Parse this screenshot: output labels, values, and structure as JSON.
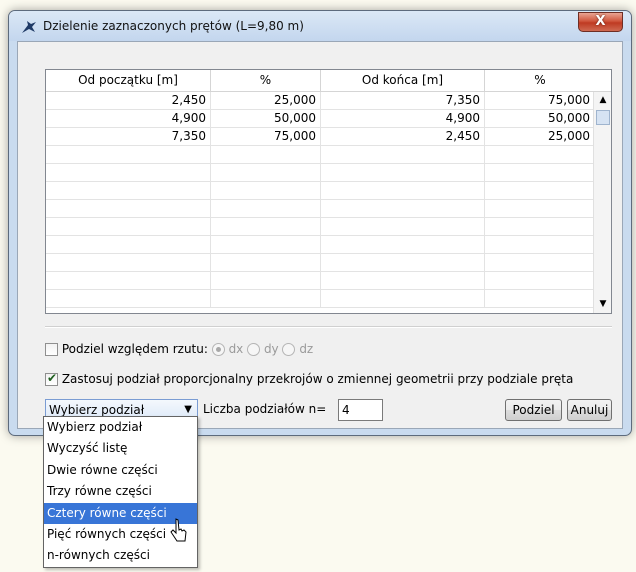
{
  "window": {
    "title": "Dzielenie zaznaczonych prętów (L=9,80 m)",
    "close_label": "X"
  },
  "grid": {
    "columns": [
      "Od początku [m]",
      "%",
      "Od końca [m]",
      "%"
    ],
    "rows": [
      [
        "2,450",
        "25,000",
        "7,350",
        "75,000"
      ],
      [
        "4,900",
        "50,000",
        "4,900",
        "50,000"
      ],
      [
        "7,350",
        "75,000",
        "2,450",
        "25,000"
      ],
      [
        "",
        "",
        "",
        ""
      ],
      [
        "",
        "",
        "",
        ""
      ],
      [
        "",
        "",
        "",
        ""
      ],
      [
        "",
        "",
        "",
        ""
      ],
      [
        "",
        "",
        "",
        ""
      ],
      [
        "",
        "",
        "",
        ""
      ],
      [
        "",
        "",
        "",
        ""
      ],
      [
        "",
        "",
        "",
        ""
      ],
      [
        "",
        "",
        "",
        ""
      ]
    ]
  },
  "options": {
    "projection_label": "Podziel względem rzutu:",
    "projection_checked": false,
    "radio_dx": "dx",
    "radio_dy": "dy",
    "radio_dz": "dz",
    "proportional_label": "Zastosuj podział proporcjonalny przekrojów o zmiennej geometrii przy podziale pręta",
    "proportional_checked": true
  },
  "controls": {
    "select_value": "Wybierz podział",
    "n_label": "Liczba podziałów n=",
    "n_value": "4",
    "divide_button": "Podziel",
    "cancel_button": "Anuluj"
  },
  "dropdown": {
    "items": [
      "Wybierz podział",
      "Wyczyść listę",
      "Dwie równe części",
      "Trzy równe części",
      "Cztery równe części",
      "Pięć równych części",
      "n-równych części"
    ],
    "highlighted_index": 4
  },
  "colors": {
    "highlight": "#3875d7",
    "window_frame": "#c9dbef",
    "close_button": "#c8472d"
  }
}
